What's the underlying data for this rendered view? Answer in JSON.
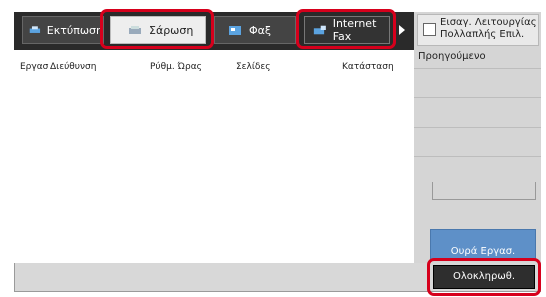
{
  "tabs": [
    {
      "label": "Εκτύπωση",
      "icon": "printer-icon"
    },
    {
      "label": "Σάρωση",
      "icon": "scanner-icon"
    },
    {
      "label": "Φαξ",
      "icon": "fax-icon"
    },
    {
      "label": "Internet Fax",
      "icon": "internet-fax-icon"
    }
  ],
  "table": {
    "columns": [
      "Εργασ",
      "Διεύθυνση",
      "Ρύθμ. Ώρας",
      "Σελίδες",
      "Κατάσταση"
    ]
  },
  "right_panel": {
    "multi_select_label": "Εισαγ. Λειτουργίας Πολλαπλής Επιλ.",
    "previous_label": "Προηγούμενο",
    "queue_button_label": "Ουρά Εργασ.",
    "done_button_label": "Ολοκληρωθ."
  },
  "colors": {
    "highlight": "#d6001c",
    "tab_bar": "#2a2a2a",
    "queue_button": "#5e90c8"
  }
}
